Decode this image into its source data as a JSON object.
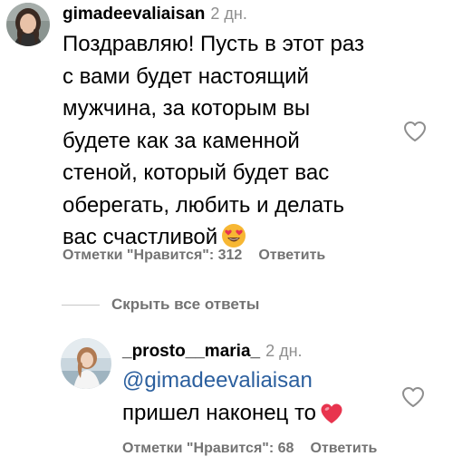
{
  "comment": {
    "username": "gimadeevaliaisan",
    "time": "2 дн.",
    "text_lines": [
      "Поздравляю! Пусть в этот раз",
      "с вами будет настоящий",
      "мужчина, за которым вы",
      "будете как за каменной",
      "стеной, который будет вас",
      "оберегать, любить и делать",
      "вас счастливой"
    ],
    "emoji": "heart-eyes-emoji",
    "likes_label": "Отметки \"Нравится\": 312",
    "reply_label": "Ответить"
  },
  "hide_replies_label": "Скрыть все ответы",
  "reply": {
    "username": "_prosto__maria_",
    "time": "2 дн.",
    "mention": "@gimadeevaliaisan",
    "text": "пришел наконец то",
    "emoji": "red-heart-emoji",
    "likes_label": "Отметки \"Нравится\": 68",
    "reply_label": "Ответить"
  },
  "colors": {
    "mention": "#2b5f9e",
    "secondary_text": "#737373",
    "heart_emoji": "#e8344e"
  }
}
